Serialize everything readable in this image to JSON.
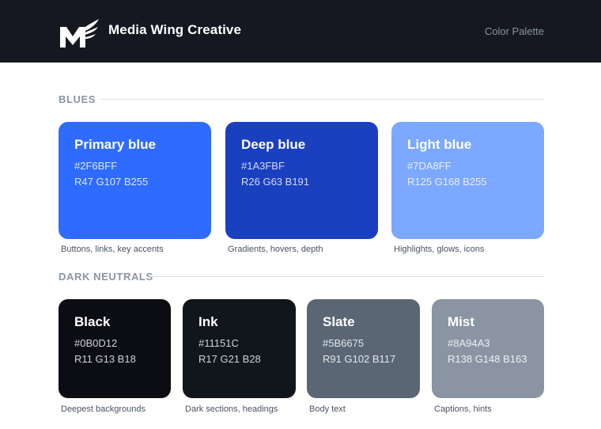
{
  "header": {
    "brand": "Media Wing Creative",
    "page_label": "Color Palette",
    "logo_icon": "m-wing-logo-icon"
  },
  "blues": {
    "title": "BLUES",
    "swatches": [
      {
        "name": "Primary blue",
        "hex": "#2F6BFF",
        "rgb": "R47 G107 B255",
        "caption": "Buttons, links, key accents"
      },
      {
        "name": "Deep blue",
        "hex": "#1A3FBF",
        "rgb": "R26 G63 B191",
        "caption": "Gradients, hovers, depth"
      },
      {
        "name": "Light blue",
        "hex": "#7DA8FF",
        "rgb": "R125 G168 B255",
        "caption": "Highlights, glows, icons"
      }
    ]
  },
  "neutrals": {
    "title": "DARK NEUTRALS",
    "swatches": [
      {
        "name": "Black",
        "hex": "#0B0D12",
        "rgb": "R11 G13 B18",
        "caption": "Deepest backgrounds"
      },
      {
        "name": "Ink",
        "hex": "#11151C",
        "rgb": "R17 G21 B28",
        "caption": "Dark sections, headings"
      },
      {
        "name": "Slate",
        "hex": "#5B6675",
        "rgb": "R91 G102 B117",
        "caption": "Body text"
      },
      {
        "name": "Mist",
        "hex": "#8A94A3",
        "rgb": "R138 G148 B163",
        "caption": "Captions, hints"
      }
    ]
  }
}
